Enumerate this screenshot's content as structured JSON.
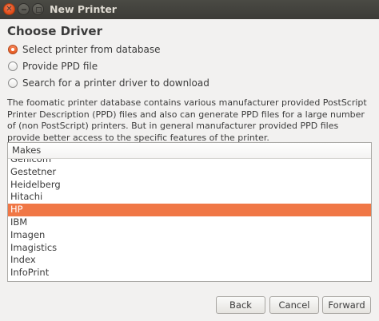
{
  "window": {
    "title": "New Printer"
  },
  "heading": "Choose Driver",
  "options": [
    {
      "label": "Select printer from database",
      "selected": true
    },
    {
      "label": "Provide PPD file",
      "selected": false
    },
    {
      "label": "Search for a printer driver to download",
      "selected": false
    }
  ],
  "description": "The foomatic printer database contains various manufacturer provided PostScript Printer Description (PPD) files and also can generate PPD files for a large number of (non PostScript) printers. But in general manufacturer provided PPD files provide better access to the specific features of the printer.",
  "makes": {
    "header": "Makes",
    "items": [
      "Genicom",
      "Gestetner",
      "Heidelberg",
      "Hitachi",
      "HP",
      "IBM",
      "Imagen",
      "Imagistics",
      "Index",
      "InfoPrint"
    ],
    "selected": "HP"
  },
  "buttons": {
    "back": "Back",
    "cancel": "Cancel",
    "forward": "Forward"
  },
  "colors": {
    "accent": "#f07746",
    "titlebar": "#3c3b37"
  }
}
